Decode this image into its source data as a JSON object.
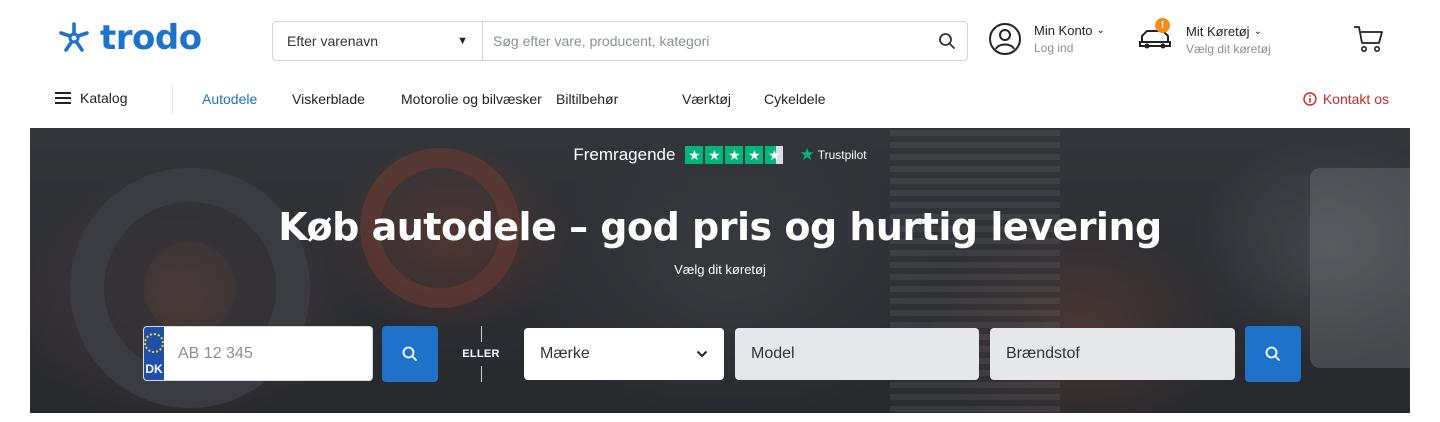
{
  "brand": {
    "name": "trodo",
    "color": "#1f72c9"
  },
  "search": {
    "mode_selected": "Efter varenavn",
    "placeholder": "Søg efter vare, producent, kategori",
    "search_icon": "search-icon"
  },
  "account": {
    "title": "Min Konto",
    "subtitle": "Log ind",
    "icon": "user-circle-icon"
  },
  "vehicle": {
    "title": "Mit Køretøj",
    "subtitle": "Vælg dit køretøj",
    "badge": "!",
    "icon": "car-icon"
  },
  "cart": {
    "icon": "cart-icon"
  },
  "nav": {
    "catalog_label": "Katalog",
    "links": [
      {
        "label": "Autodele",
        "active": true
      },
      {
        "label": "Viskerblade",
        "active": false
      },
      {
        "label": "Motorolie og bilvæsker",
        "active": false
      },
      {
        "label": "Biltilbehør",
        "active": false
      },
      {
        "label": "Værktøj",
        "active": false
      },
      {
        "label": "Cykeldele",
        "active": false
      }
    ],
    "contact_label": "Kontakt os",
    "contact_color": "#c92a2a"
  },
  "hero": {
    "rating_label": "Fremragende",
    "rating_stars": 4.5,
    "trustpilot_label": "Trustpilot",
    "title": "Køb autodele – god pris og hurtig levering",
    "subtitle": "Vælg dit køretøj",
    "plate_country": "DK",
    "plate_placeholder": "AB 12 345",
    "or_label": "ELLER",
    "brand_select": "Mærke",
    "model_select": "Model",
    "fuel_select": "Brændstof",
    "accent_color": "#1f72c9"
  }
}
